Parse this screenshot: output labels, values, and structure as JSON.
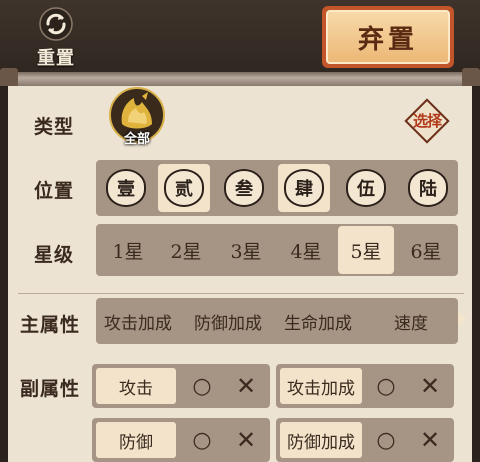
{
  "header": {
    "reset_label": "重置",
    "discard_label": "弃置"
  },
  "filters": {
    "type": {
      "label": "类型",
      "selected": "全部",
      "select_label": "选择"
    },
    "position": {
      "label": "位置",
      "options": [
        "壹",
        "贰",
        "叁",
        "肆",
        "伍",
        "陆"
      ],
      "selected": [
        "贰",
        "肆"
      ]
    },
    "star": {
      "label": "星级",
      "options": [
        "1星",
        "2星",
        "3星",
        "4星",
        "5星",
        "6星"
      ],
      "selected": "5星"
    },
    "main_attr": {
      "label": "主属性",
      "options": [
        "攻击加成",
        "防御加成",
        "生命加成",
        "速度"
      ]
    },
    "sub_attr": {
      "label": "副属性",
      "items": [
        {
          "name": "攻击",
          "o": "○",
          "x": "✕"
        },
        {
          "name": "攻击加成",
          "o": "○",
          "x": "✕"
        },
        {
          "name": "防御",
          "o": "○",
          "x": "✕"
        },
        {
          "name": "防御加成",
          "o": "○",
          "x": "✕"
        }
      ]
    }
  },
  "colors": {
    "accent": "#c2552a",
    "panel": "#ece3d2",
    "row": "#a69584",
    "selected": "#f2e3ca"
  }
}
